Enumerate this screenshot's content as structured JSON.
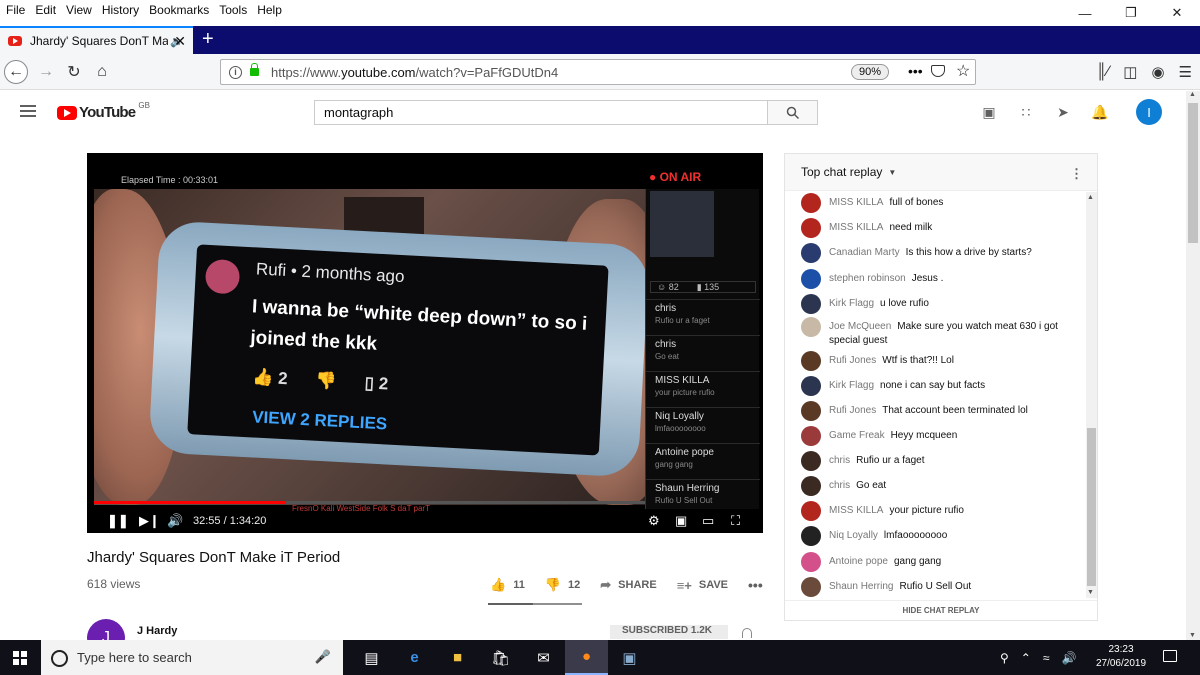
{
  "browser": {
    "menu": [
      "File",
      "Edit",
      "View",
      "History",
      "Bookmarks",
      "Tools",
      "Help"
    ],
    "tab_title": "Jhardy' Squares DonT Make iT Period",
    "url_prefix": "https://www.",
    "url_domain": "youtube.com",
    "url_rest": "/watch?v=PaFfGDUtDn4",
    "zoom": "90%"
  },
  "youtube": {
    "country": "GB",
    "search_value": "montagraph",
    "user_initial": "I"
  },
  "player": {
    "elapsed_label": "Elapsed Time : 00:33:01",
    "on_air": "ON AIR",
    "comment_head": "Rufi • 2 months ago",
    "comment_text": "I wanna be “white deep down” to so i joined the kkk",
    "comment_likes": "2",
    "comment_replies_count": "2",
    "view_replies": "VIEW 2 REPLIES",
    "overlay_caption": "FresnO Kali WestSide Folk S daT parT",
    "side_counts": {
      "viewers": "82",
      "comments": "135"
    },
    "side_messages": [
      {
        "name": "chris",
        "text": "Rufio ur a faget"
      },
      {
        "name": "chris",
        "text": "Go eat"
      },
      {
        "name": "MISS KILLA",
        "text": "your picture rufio"
      },
      {
        "name": "Niq Loyally",
        "text": "lmfaoooooooo"
      },
      {
        "name": "Antoine pope",
        "text": "gang gang"
      },
      {
        "name": "Shaun Herring",
        "text": "Rufio U Sell Out"
      }
    ],
    "timecode": "32:55 / 1:34:20",
    "progress": 0.349
  },
  "video": {
    "title": "Jhardy' Squares DonT Make iT Period",
    "views": "618 views",
    "likes": "11",
    "dislikes": "12",
    "share": "SHARE",
    "save": "SAVE",
    "channel_initial": "J",
    "channel_name": "J Hardy",
    "subscribed": "SUBSCRIBED  1.2K",
    "like_ratio": 0.48
  },
  "chat": {
    "header": "Top chat replay",
    "footer": "HIDE CHAT REPLAY",
    "messages": [
      {
        "author": "MISS KILLA",
        "text": "full of bones",
        "color": "#b3261e"
      },
      {
        "author": "MISS KILLA",
        "text": "need milk",
        "color": "#b3261e"
      },
      {
        "author": "Canadian Marty",
        "text": "Is this how a drive by starts?",
        "color": "#2a3b70"
      },
      {
        "author": "stephen robinson",
        "text": "Jesus .",
        "color": "#1c4fa8"
      },
      {
        "author": "Kirk Flagg",
        "text": "u love rufio",
        "color": "#2b3550"
      },
      {
        "author": "Joe McQueen",
        "text": "Make sure you watch meat 630 i got special guest",
        "color": "#c8b9a6"
      },
      {
        "author": "Rufi Jones",
        "text": "Wtf is that?!! Lol",
        "color": "#5a3a24"
      },
      {
        "author": "Kirk Flagg",
        "text": "none i can say but facts",
        "color": "#2b3550"
      },
      {
        "author": "Rufi Jones",
        "text": "That account been terminated lol",
        "color": "#5a3a24"
      },
      {
        "author": "Game Freak",
        "text": "Heyy mcqueen",
        "color": "#9a3a3a"
      },
      {
        "author": "chris",
        "text": "Rufio ur a faget",
        "color": "#3a2a22"
      },
      {
        "author": "chris",
        "text": "Go eat",
        "color": "#3a2a22"
      },
      {
        "author": "MISS KILLA",
        "text": "your picture rufio",
        "color": "#b3261e"
      },
      {
        "author": "Niq Loyally",
        "text": "lmfaoooooooo",
        "color": "#222222"
      },
      {
        "author": "Antoine pope",
        "text": "gang gang",
        "color": "#d4508a"
      },
      {
        "author": "Shaun Herring",
        "text": "Rufio U Sell Out",
        "color": "#6a4a3a"
      }
    ]
  },
  "taskbar": {
    "search_placeholder": "Type here to search",
    "time": "23:23",
    "date": "27/06/2019"
  }
}
